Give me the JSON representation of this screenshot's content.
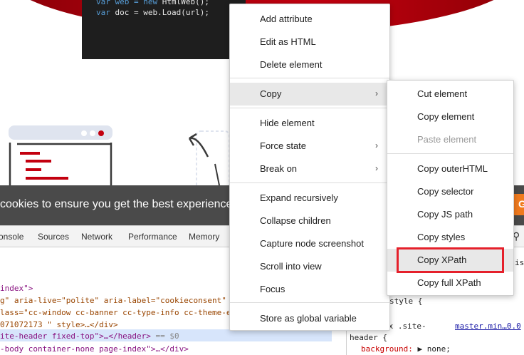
{
  "code": {
    "line1_prefix": "var web = ",
    "line1_kw": "new",
    "line1_rest": " HtmlWeb();",
    "line2_kw": "var",
    "line2_rest": " doc = web.Load(url);"
  },
  "cookie": {
    "text": "cookies to ensure you get the best experience",
    "button": "G"
  },
  "devtools": {
    "tabs": [
      "onsole",
      "Sources",
      "Network",
      "Performance",
      "Memory"
    ],
    "lines": [
      {
        "a": "index\">"
      },
      {
        "a": "g\" aria-live=\"polite\" aria-label=\"cookieconsent\""
      },
      {
        "a": "lass=\"cc-window cc-banner cc-type-info cc-theme-e"
      },
      {
        "a": "071072173 \" style>…</div>"
      },
      {
        "a": "ite-header fixed-top\">…</header>",
        "dim": " == $0"
      },
      {
        "a": "-body container-none page-index\">…</div>"
      }
    ],
    "styles": {
      "line1": "style {",
      "line2_a": "ex .site-",
      "line2_link": "master.min…0.0",
      "line3": "header {",
      "line4_prop": "background:",
      "line4_val": "▶ none;",
      "line5": "iste"
    }
  },
  "menu": {
    "items": [
      {
        "label": "Add attribute"
      },
      {
        "label": "Edit as HTML"
      },
      {
        "label": "Delete element"
      },
      {
        "label": "Copy",
        "arrow": "›"
      },
      {
        "label": "Hide element"
      },
      {
        "label": "Force state",
        "arrow": "›"
      },
      {
        "label": "Break on",
        "arrow": "›"
      },
      {
        "label": "Expand recursively"
      },
      {
        "label": "Collapse children"
      },
      {
        "label": "Capture node screenshot"
      },
      {
        "label": "Scroll into view"
      },
      {
        "label": "Focus"
      },
      {
        "label": "Store as global variable"
      }
    ]
  },
  "submenu": {
    "items": [
      {
        "label": "Cut element"
      },
      {
        "label": "Copy element"
      },
      {
        "label": "Paste element"
      },
      {
        "label": "Copy outerHTML"
      },
      {
        "label": "Copy selector"
      },
      {
        "label": "Copy JS path"
      },
      {
        "label": "Copy styles"
      },
      {
        "label": "Copy XPath"
      },
      {
        "label": "Copy full XPath"
      }
    ]
  },
  "colors": {
    "highlight_box": "#e5202b",
    "banner_red": "#c3000f",
    "cookie_button": "#f07a1e"
  }
}
